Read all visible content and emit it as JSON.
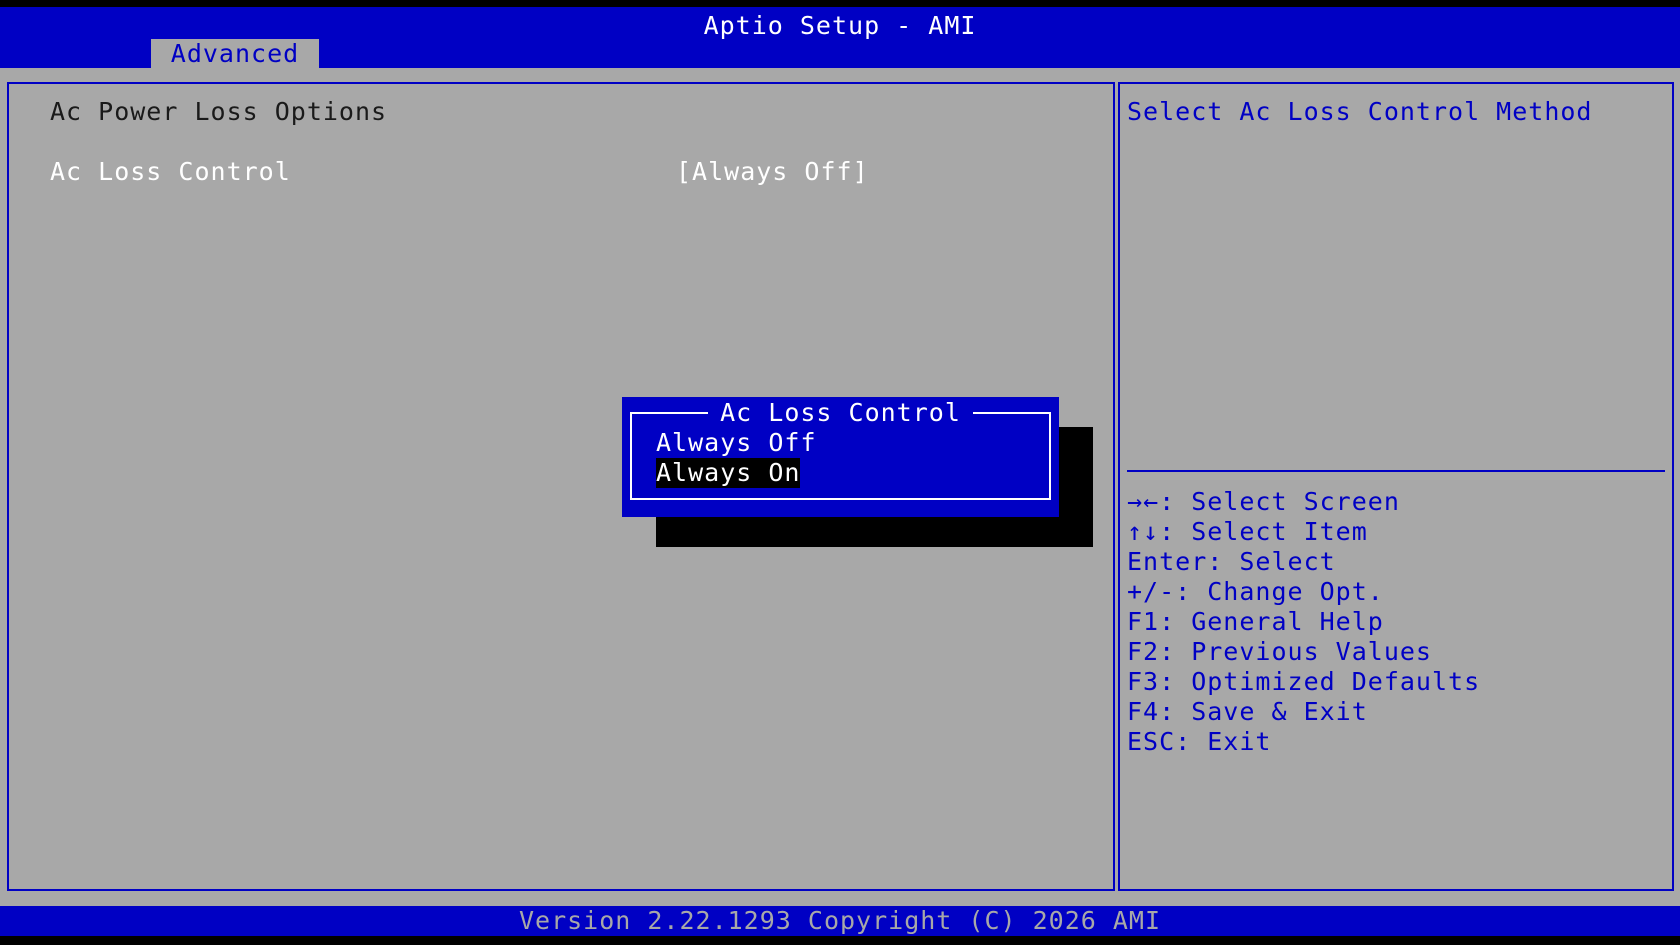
{
  "header": {
    "title": "Aptio Setup - AMI",
    "tabs": [
      "Advanced"
    ]
  },
  "main": {
    "section_title": "Ac Power Loss Options",
    "settings": [
      {
        "label": "Ac Loss Control",
        "value": "[Always Off]"
      }
    ]
  },
  "help": {
    "text": "Select Ac Loss Control Method",
    "keys": [
      "→←: Select Screen",
      "↑↓: Select Item",
      "Enter: Select",
      "+/-: Change Opt.",
      "F1: General Help",
      "F2: Previous Values",
      "F3: Optimized Defaults",
      "F4: Save & Exit",
      "ESC: Exit"
    ]
  },
  "popup": {
    "title": "Ac Loss Control",
    "options": [
      "Always Off",
      "Always On"
    ],
    "highlighted_option": "Always On"
  },
  "footer": {
    "text": "Version 2.22.1293 Copyright (C) 2026 AMI"
  },
  "colors": {
    "bios_blue": "#0000c4",
    "bios_gray": "#a8a8a8",
    "highlight_bg": "#000000",
    "text_white": "#ffffff"
  }
}
